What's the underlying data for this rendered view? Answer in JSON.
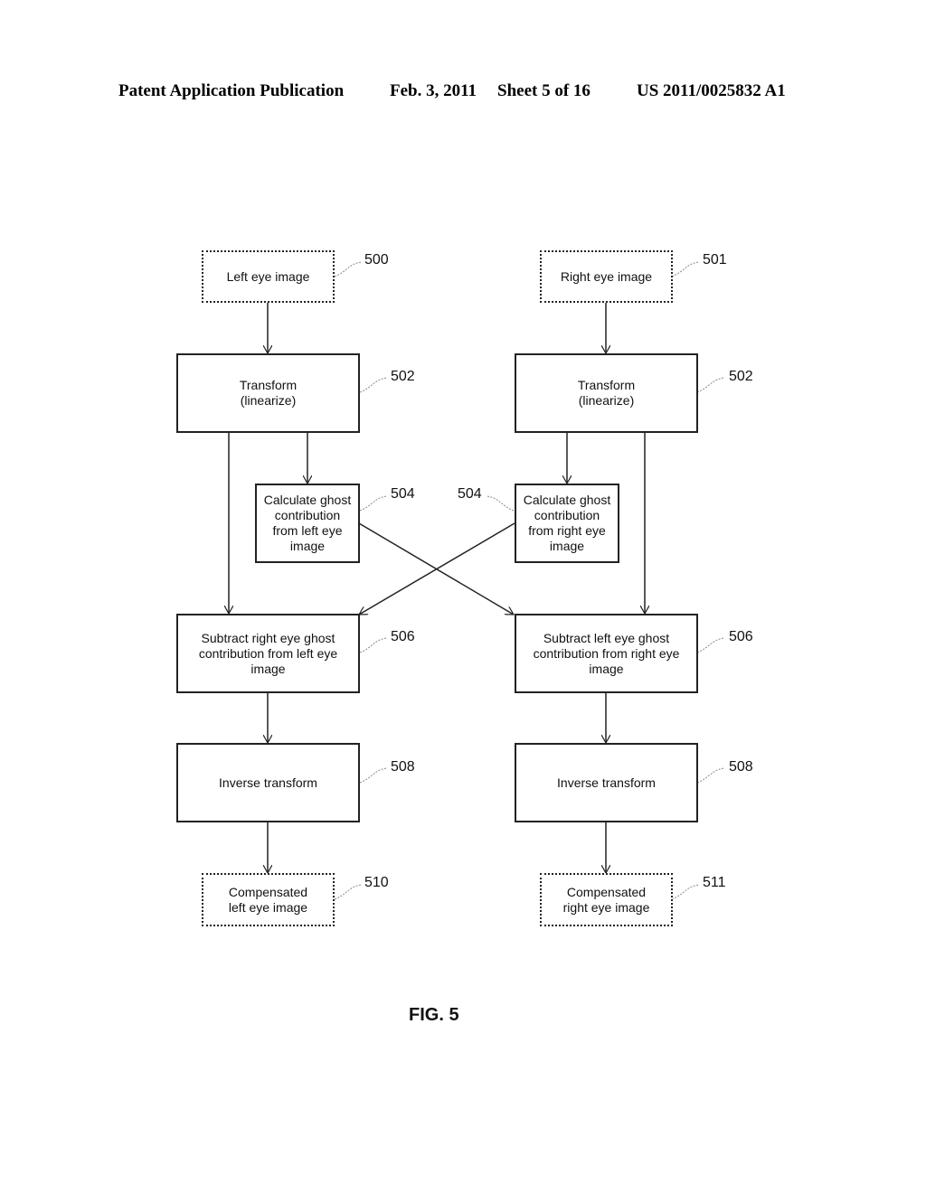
{
  "header": {
    "publication": "Patent Application Publication",
    "date": "Feb. 3, 2011",
    "sheet": "Sheet 5 of 16",
    "number": "US 2011/0025832 A1"
  },
  "nodes": {
    "left_input": {
      "label": "Left eye image",
      "ref": "500"
    },
    "right_input": {
      "label": "Right eye image",
      "ref": "501"
    },
    "left_transform": {
      "label": "Transform\n(linearize)",
      "ref": "502"
    },
    "right_transform": {
      "label": "Transform\n(linearize)",
      "ref": "502"
    },
    "left_ghost": {
      "label": "Calculate ghost\ncontribution\nfrom left eye\nimage",
      "ref": "504"
    },
    "right_ghost": {
      "label": "Calculate ghost\ncontribution\nfrom right eye\nimage",
      "ref": "504"
    },
    "left_subtract": {
      "label": "Subtract right eye ghost\ncontribution from left eye\nimage",
      "ref": "506"
    },
    "right_subtract": {
      "label": "Subtract left eye ghost\ncontribution from right eye\nimage",
      "ref": "506"
    },
    "left_inverse": {
      "label": "Inverse transform",
      "ref": "508"
    },
    "right_inverse": {
      "label": "Inverse transform",
      "ref": "508"
    },
    "left_output": {
      "label": "Compensated\nleft eye image",
      "ref": "510"
    },
    "right_output": {
      "label": "Compensated\nright eye image",
      "ref": "511"
    }
  },
  "figure_label": "FIG. 5"
}
